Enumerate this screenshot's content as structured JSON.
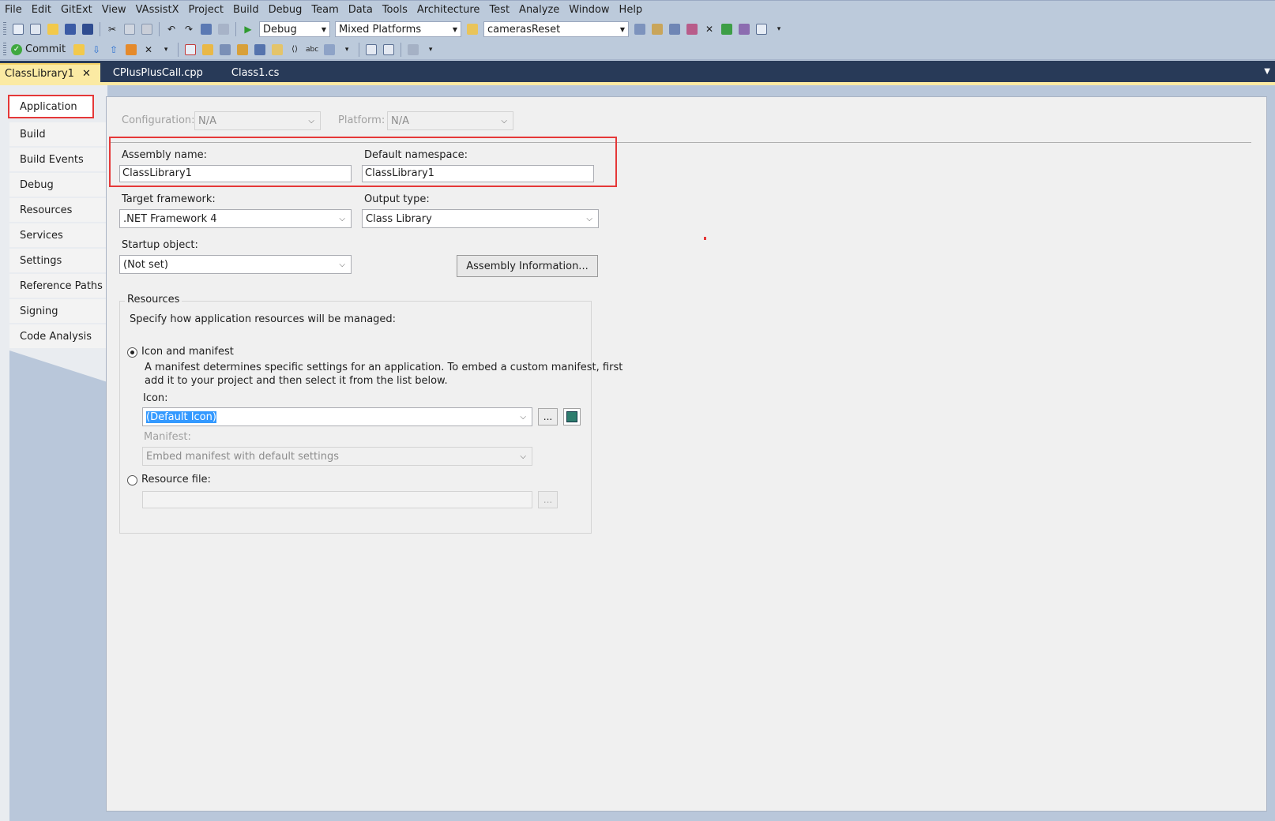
{
  "menu": [
    "File",
    "Edit",
    "GitExt",
    "View",
    "VAssistX",
    "Project",
    "Build",
    "Debug",
    "Team",
    "Data",
    "Tools",
    "Architecture",
    "Test",
    "Analyze",
    "Window",
    "Help"
  ],
  "toolbar": {
    "config_value": "Debug",
    "platform_value": "Mixed Platforms",
    "find_value": "camerasReset",
    "commit_label": "Commit"
  },
  "tabs": [
    {
      "label": "ClassLibrary1",
      "active": true
    },
    {
      "label": "CPlusPlusCall.cpp",
      "active": false
    },
    {
      "label": "Class1.cs",
      "active": false
    }
  ],
  "sidebar": {
    "items": [
      "Application",
      "Build",
      "Build Events",
      "Debug",
      "Resources",
      "Services",
      "Settings",
      "Reference Paths",
      "Signing",
      "Code Analysis"
    ]
  },
  "form": {
    "configuration_label": "Configuration:",
    "configuration_value": "N/A",
    "platform_label": "Platform:",
    "platform_value": "N/A",
    "assembly_name_label": "Assembly name:",
    "assembly_name_value": "ClassLibrary1",
    "default_namespace_label": "Default namespace:",
    "default_namespace_value": "ClassLibrary1",
    "target_framework_label": "Target framework:",
    "target_framework_value": ".NET Framework 4",
    "output_type_label": "Output type:",
    "output_type_value": "Class Library",
    "startup_object_label": "Startup object:",
    "startup_object_value": "(Not set)",
    "assembly_info_button": "Assembly Information..."
  },
  "resources": {
    "group_label": "Resources",
    "description": "Specify how application resources will be managed:",
    "icon_manifest_label": "Icon and manifest",
    "manifest_description_line1": "A manifest determines specific settings for an application. To embed a custom manifest, first",
    "manifest_description_line2": "add it to your project and then select it from the list below.",
    "icon_label": "Icon:",
    "icon_value": "(Default Icon)",
    "browse_label": "...",
    "manifest_label": "Manifest:",
    "manifest_value": "Embed manifest with default settings",
    "resource_file_label": "Resource file:"
  },
  "colors": {
    "highlight_red": "#e53838",
    "tab_active": "#fbeaa3",
    "tab_strip": "#283a58",
    "toolbar": "#bccadb"
  }
}
